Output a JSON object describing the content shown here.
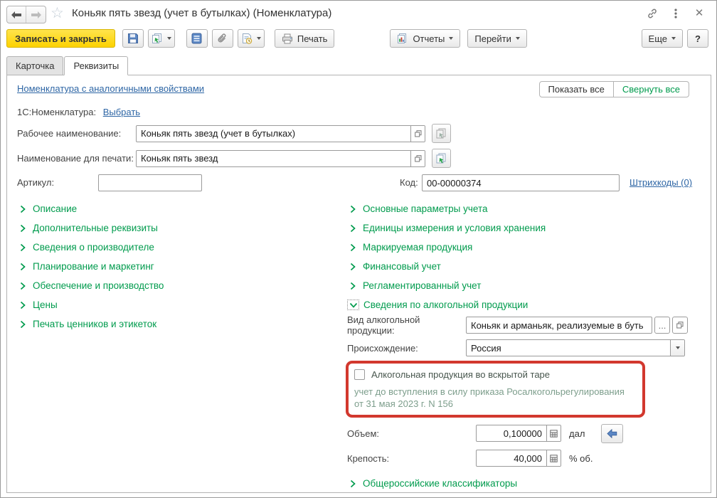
{
  "window": {
    "title": "Коньяк пять звезд (учет в бутылках) (Номенклатура)"
  },
  "toolbar": {
    "save_and_close": "Записать и закрыть",
    "print_label": "Печать",
    "reports_label": "Отчеты",
    "goto_label": "Перейти",
    "more_label": "Еще",
    "help_label": "?"
  },
  "tabs": {
    "card": "Карточка",
    "details": "Реквизиты"
  },
  "header": {
    "similar_link": "Номенклатура с аналогичными свойствами",
    "show_all": "Показать все",
    "collapse_all": "Свернуть все",
    "nomenclature_label": "1С:Номенклатура:",
    "choose_link": "Выбрать"
  },
  "fields": {
    "working_name": {
      "label": "Рабочее наименование:",
      "value": "Коньяк пять звезд (учет в бутылках)"
    },
    "print_name": {
      "label": "Наименование для печати:",
      "value": "Коньяк пять звезд"
    },
    "article": {
      "label": "Артикул:",
      "value": ""
    },
    "code": {
      "label": "Код:",
      "value": "00-00000374"
    },
    "barcodes_link": "Штрихкоды (0)"
  },
  "left_sections": [
    "Описание",
    "Дополнительные реквизиты",
    "Сведения о производителе",
    "Планирование и маркетинг",
    "Обеспечение и производство",
    "Цены",
    "Печать ценников и этикеток"
  ],
  "right_sections": [
    "Основные параметры учета",
    "Единицы измерения и условия хранения",
    "Маркируемая продукция",
    "Финансовый учет",
    "Регламентированный учет"
  ],
  "alcohol": {
    "section_title": "Сведения по алкогольной продукции",
    "kind_label": "Вид алкогольной продукции:",
    "kind_value": "Коньяк и арманьяк, реализуемые в буть",
    "ellipsis_label": "...",
    "origin_label": "Происхождение:",
    "origin_value": "Россия",
    "opened_checkbox_label": "Алкогольная продукция во вскрытой таре",
    "note": "учет до вступления в силу приказа Росалкогольрегулирования от 31 мая 2023 г. N 156",
    "volume_label": "Объем:",
    "volume_value": "0,100000",
    "volume_unit": "дал",
    "strength_label": "Крепость:",
    "strength_value": "40,000",
    "strength_unit": "% об."
  },
  "bottom_section_label": "Общероссийские классификаторы",
  "colors": {
    "accent_green": "#009b4d",
    "link_blue": "#2e66a5",
    "highlight_red": "#d2382e",
    "button_yellow": "#fdd200"
  }
}
